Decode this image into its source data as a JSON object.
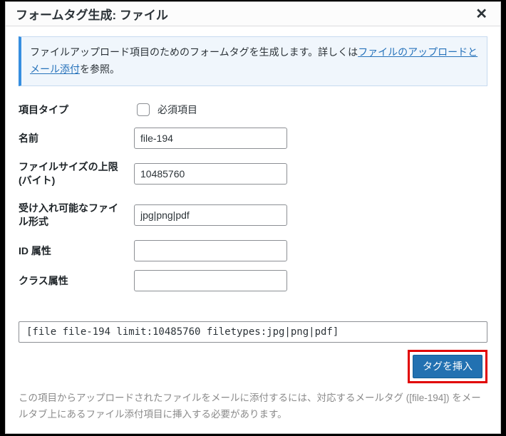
{
  "dialog": {
    "title": "フォームタグ生成: ファイル"
  },
  "info": {
    "prefix": "ファイルアップロード項目のためのフォームタグを生成します。詳しくは",
    "link": "ファイルのアップロードとメール添付",
    "suffix": "を参照。"
  },
  "fields": {
    "type_label": "項目タイプ",
    "required_label": "必須項目",
    "name_label": "名前",
    "name_value": "file-194",
    "limit_label": "ファイルサイズの上限 (バイト)",
    "limit_value": "10485760",
    "filetypes_label": "受け入れ可能なファイル形式",
    "filetypes_value": "jpg|png|pdf",
    "id_label": "ID 属性",
    "id_value": "",
    "class_label": "クラス属性",
    "class_value": ""
  },
  "output": {
    "tag": "[file file-194 limit:10485760 filetypes:jpg|png|pdf]",
    "insert_button": "タグを挿入"
  },
  "note": {
    "p1a": "この項目からアップロードされたファイルをメールに添付するには、対応するメールタグ (",
    "p1b": "[file-194]",
    "p1c": ") をメールタブ上にあるファイル添付項目に挿入する必要があります。"
  }
}
